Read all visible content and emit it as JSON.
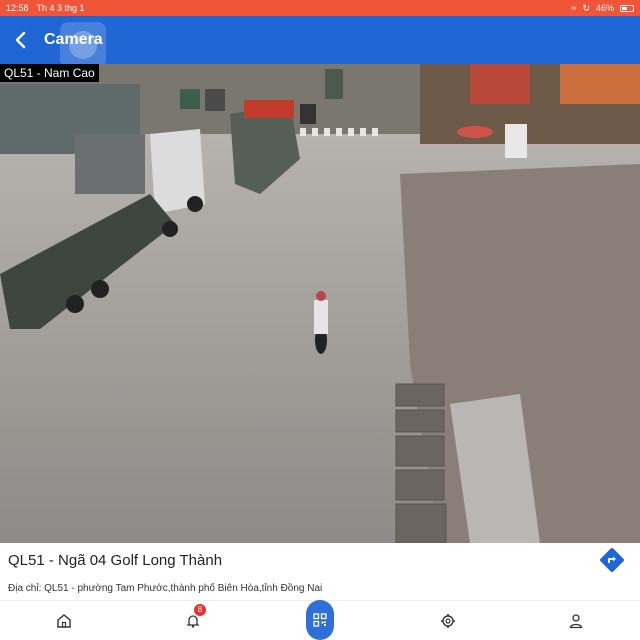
{
  "status_bar": {
    "time": "12:58",
    "date": "Th 4 3 thg 1",
    "battery": "46%"
  },
  "app_bar": {
    "title": "Camera",
    "back_icon": "chevron-left-icon"
  },
  "camera": {
    "overlay_label": "QL51 - Nam Cao"
  },
  "location": {
    "name": "QL51 - Ngã 04 Golf Long Thành",
    "address": "Địa chỉ: QL51 - phường Tam Phước,thành phố Biên Hòa,tỉnh Đồng Nai",
    "directions_icon": "directions-icon"
  },
  "bottom_nav": {
    "items": [
      {
        "name": "home",
        "icon": "home-icon"
      },
      {
        "name": "notifications",
        "icon": "bell-icon",
        "badge": "8"
      },
      {
        "name": "qr",
        "icon": "qr-code-icon"
      },
      {
        "name": "settings",
        "icon": "gear-icon"
      },
      {
        "name": "profile",
        "icon": "user-icon"
      }
    ]
  },
  "colors": {
    "status_bar": "#f0553a",
    "app_bar": "#2066d4",
    "accent": "#2f6fd8",
    "badge": "#e5322e"
  }
}
